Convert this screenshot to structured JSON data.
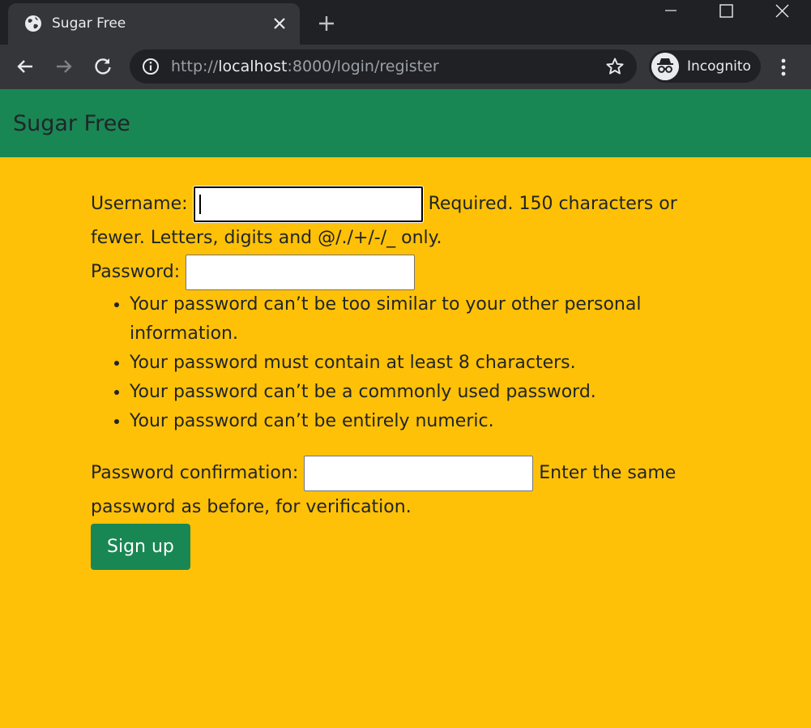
{
  "browser": {
    "tab_title": "Sugar Free",
    "url_scheme": "http://",
    "url_host": "localhost",
    "url_rest": ":8000/login/register",
    "profile_label": "Incognito"
  },
  "navbar": {
    "brand": "Sugar Free"
  },
  "form": {
    "username_label": "Username:",
    "username_help": "Required. 150 characters or fewer. Letters, digits and @/./+/-/_ only.",
    "password_label": "Password:",
    "password_rules": [
      "Your password can’t be too similar to your other personal information.",
      "Your password must contain at least 8 characters.",
      "Your password can’t be a commonly used password.",
      "Your password can’t be entirely numeric."
    ],
    "confirm_label": "Password confirmation:",
    "confirm_help": "Enter the same password as before, for verification.",
    "submit_label": "Sign up"
  },
  "colors": {
    "page_bg": "#ffc107",
    "navbar_bg": "#198754",
    "button_bg": "#198754",
    "chrome_dark": "#202124",
    "chrome_mid": "#35363a"
  },
  "icons": [
    "globe-icon",
    "close-icon",
    "plus-icon",
    "minimize-icon",
    "maximize-icon",
    "window-close-icon",
    "back-arrow-icon",
    "forward-arrow-icon",
    "reload-icon",
    "info-icon",
    "star-icon",
    "incognito-icon",
    "more-vert-icon"
  ]
}
